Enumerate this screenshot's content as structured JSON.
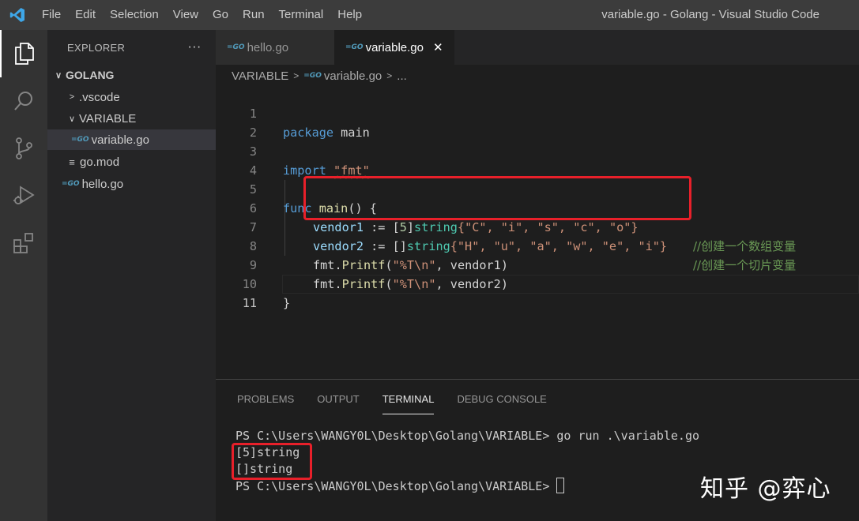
{
  "titlebar": {
    "menu": [
      "File",
      "Edit",
      "Selection",
      "View",
      "Go",
      "Run",
      "Terminal",
      "Help"
    ],
    "window_title": "variable.go - Golang - Visual Studio Code"
  },
  "activitybar": {
    "icons": [
      "explorer-icon",
      "search-icon",
      "source-control-icon",
      "run-debug-icon",
      "extensions-icon"
    ]
  },
  "sidebar": {
    "title": "EXPLORER",
    "more": "···",
    "root": "GOLANG",
    "items": [
      {
        "label": ".vscode",
        "type": "folder",
        "expanded": false
      },
      {
        "label": "VARIABLE",
        "type": "folder",
        "expanded": true
      },
      {
        "label": "variable.go",
        "type": "go-file",
        "selected": true
      },
      {
        "label": "go.mod",
        "type": "mod-file"
      },
      {
        "label": "hello.go",
        "type": "go-file"
      }
    ]
  },
  "tabs": [
    {
      "label": "hello.go",
      "active": false
    },
    {
      "label": "variable.go",
      "active": true
    }
  ],
  "breadcrumb": {
    "folder": "VARIABLE",
    "file": "variable.go",
    "more": "..."
  },
  "editor": {
    "line_numbers": [
      "1",
      "2",
      "3",
      "4",
      "5",
      "6",
      "7",
      "8",
      "9",
      "10",
      "11"
    ],
    "current_line": "11",
    "code": {
      "l1_kw": "package",
      "l1_name": " main",
      "l3_kw": "import",
      "l3_str": "\"fmt\"",
      "l5_kw": "func",
      "l5_fn": "main",
      "l5_rest": "() {",
      "l6_var": "vendor1",
      "l6_op": " := [",
      "l6_num": "5",
      "l6_close": "]",
      "l6_type": "string",
      "l6_values": "{\"C\", \"i\", \"s\", \"c\", \"o\"}",
      "l6_comment": "//创建一个数组变量",
      "l7_var": "vendor2",
      "l7_op": " := []",
      "l7_type": "string",
      "l7_values": "{\"H\", \"u\", \"a\", \"w\", \"e\", \"i\"}",
      "l7_comment": "//创建一个切片变量",
      "l8_pkg": "fmt",
      "l8_fn": "Printf",
      "l8_str": "\"%T\\n\"",
      "l8_arg": "vendor1",
      "l9_pkg": "fmt",
      "l9_fn": "Printf",
      "l9_str": "\"%T\\n\"",
      "l9_arg": "vendor2",
      "l10": "}"
    }
  },
  "panel": {
    "tabs": [
      "PROBLEMS",
      "OUTPUT",
      "TERMINAL",
      "DEBUG CONSOLE"
    ],
    "active_tab": "TERMINAL",
    "terminal": [
      "PS C:\\Users\\WANGY0L\\Desktop\\Golang\\VARIABLE> go run .\\variable.go",
      "[5]string",
      "[]string",
      "PS C:\\Users\\WANGY0L\\Desktop\\Golang\\VARIABLE> "
    ]
  },
  "watermark": "知乎 @弈心",
  "colors": {
    "highlight_box": "#e8202a",
    "keyword": "#569cd6",
    "string": "#ce9178",
    "type": "#4ec9b0",
    "comment": "#6a9955"
  }
}
